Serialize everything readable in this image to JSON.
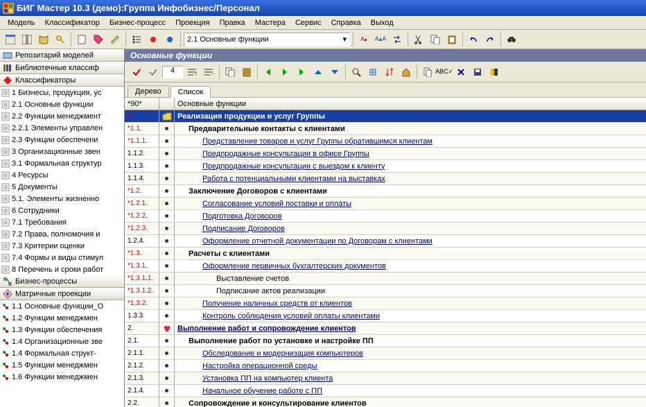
{
  "window": {
    "title": "БИГ Мастер 10.3 (демо):Группа Инфобизнес/Персонал"
  },
  "menu": [
    "Модель",
    "Классификатор",
    "Бизнес-процесс",
    "Проекция",
    "Правка",
    "Мастера",
    "Сервис",
    "Справка",
    "Выход"
  ],
  "combo": "2.1 Основные функции",
  "sidebar": {
    "sec0": "Репозитарий моделей",
    "sec1": "Библиотечные классиф",
    "sec2": "Классификаторы",
    "tree2": [
      "1 Бизнесы, продукция, ус",
      "2.1 Основные функции",
      "2.2 Функции менеджмент",
      "2.2.1 Элементы управлен",
      "2.3 Функции обеспечени",
      "3 Организационные звен",
      "3.1 Формальная структур",
      "4 Ресурсы",
      "5 Документы",
      "5.1. Элементы жизненно",
      "6 Сотрудники",
      "7.1 Требования",
      "7.2 Права, полномочия и",
      "7.3 Критерии оценки",
      "7.4 Формы и виды стимул",
      "8 Перечень и сроки работ"
    ],
    "sec3": "Бизнес-процессы",
    "sec4": "Матричные проекции",
    "tree4": [
      "1.1 Основные функции_О",
      "1.2 Функции менеджмен",
      "1.3 Функции обеспечения",
      "1.4 Организационные зве",
      "1.4 Формальная структ-",
      "1.5 Функции менеджмен",
      "1.6 Функции менеджмен"
    ]
  },
  "right": {
    "title": "Основные функции",
    "num": "4",
    "tabs": [
      "Дерево",
      "Список"
    ],
    "hdr_col1": "*90*",
    "hdr_col3": "Основные функции",
    "rows": [
      {
        "n": "*1.",
        "red": true,
        "sel": true,
        "bold": true,
        "ind": 0,
        "icon": "folder",
        "t": "Реализация продукции и услуг Группы"
      },
      {
        "n": "*1.1.",
        "red": true,
        "bullet": true,
        "bold": true,
        "ind": 1,
        "t": "Предварительные контакты с клиентами"
      },
      {
        "n": "*1.1.1.",
        "red": true,
        "bullet": true,
        "link": true,
        "ind": 2,
        "t": "Представление товаров и услуг Группы обратившимся клиентам"
      },
      {
        "n": "1.1.2.",
        "bullet": true,
        "link": true,
        "ind": 2,
        "t": "Предпродажные консультации в офисе Группы"
      },
      {
        "n": "1.1.3.",
        "bullet": true,
        "link": true,
        "ind": 2,
        "t": "Предпродажные консультации с выездом к клиенту"
      },
      {
        "n": "1.1.4.",
        "bullet": true,
        "link": true,
        "ind": 2,
        "t": "Работа с потенциальными клиентами на выставках"
      },
      {
        "n": "*1.2.",
        "red": true,
        "bullet": true,
        "bold": true,
        "ind": 1,
        "t": "Заключение Договоров с клиентами"
      },
      {
        "n": "*1.2.1.",
        "red": true,
        "bullet": true,
        "link": true,
        "ind": 2,
        "t": "Согласование условий поставки и оплаты"
      },
      {
        "n": "*1.2.2.",
        "red": true,
        "bullet": true,
        "link": true,
        "ind": 2,
        "t": "Подготовка Договоров"
      },
      {
        "n": "*1.2.3.",
        "red": true,
        "bullet": true,
        "link": true,
        "ind": 2,
        "t": "Подписание Договоров"
      },
      {
        "n": "1.2.4.",
        "bullet": true,
        "link": true,
        "ind": 2,
        "t": "Оформление отчетной документации по Договорам с клиентами"
      },
      {
        "n": "*1.3.",
        "red": true,
        "bullet": true,
        "bold": true,
        "ind": 1,
        "t": "Расчеты с клиентами"
      },
      {
        "n": "*1.3.1.",
        "red": true,
        "bullet": true,
        "link": true,
        "ind": 2,
        "t": "Оформление первичных бухгалтерских документов"
      },
      {
        "n": "*1.3.1.1.",
        "red": true,
        "bullet": true,
        "ind": 3,
        "t": "Выставление счетов"
      },
      {
        "n": "*1.3.1.2.",
        "red": true,
        "bullet": true,
        "ind": 3,
        "t": "Подписание актов реализации"
      },
      {
        "n": "*1.3.2.",
        "red": true,
        "bullet": true,
        "link": true,
        "ind": 2,
        "t": "Получение наличных средств от клиентов"
      },
      {
        "n": "1.3.3.",
        "bullet": true,
        "link": true,
        "ind": 2,
        "t": "Контроль соблюдения условий оплаты клиентами"
      },
      {
        "n": "2.",
        "icon": "heart",
        "bold": true,
        "link": true,
        "ind": 0,
        "t": "Выполнение работ и сопровождение клиентов"
      },
      {
        "n": "2.1.",
        "bullet": true,
        "bold": true,
        "ind": 1,
        "t": "Выполнение работ по установке и настройке ПП"
      },
      {
        "n": "2.1.1.",
        "bullet": true,
        "link": true,
        "ind": 2,
        "t": "Обследование и модернизация компьютеров"
      },
      {
        "n": "2.1.2.",
        "bullet": true,
        "link": true,
        "ind": 2,
        "t": "Настройка операционной среды"
      },
      {
        "n": "2.1.3.",
        "bullet": true,
        "link": true,
        "ind": 2,
        "t": "Установка ПП на компьютер клиента"
      },
      {
        "n": "2.1.4.",
        "bullet": true,
        "link": true,
        "ind": 2,
        "t": "Начальное обучение работе с ПП"
      },
      {
        "n": "2.2.",
        "bullet": true,
        "bold": true,
        "ind": 1,
        "t": "Сопровождение и консультирование клиентов"
      }
    ]
  }
}
